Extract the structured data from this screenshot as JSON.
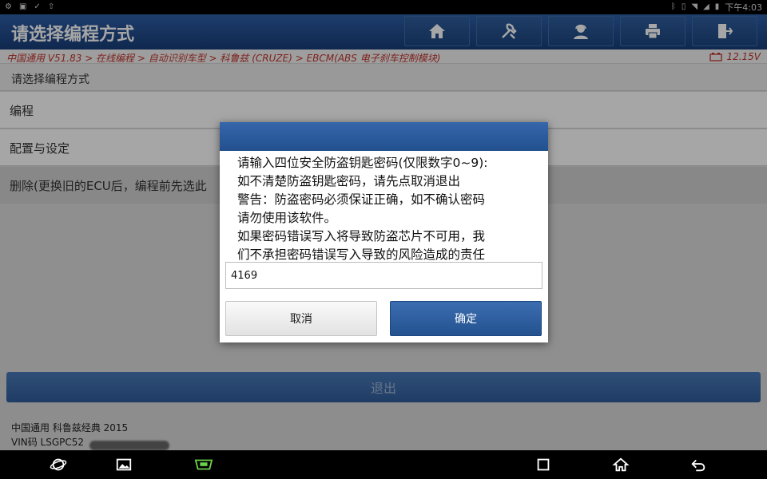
{
  "status_bar": {
    "left_icons": [
      "settings-icon",
      "image-icon",
      "check-icon",
      "upload-icon"
    ],
    "right_icons": [
      "bluetooth-icon",
      "vibrate-icon",
      "wifi-icon",
      "signal-icon",
      "battery-icon"
    ],
    "time": "下午4:03"
  },
  "header": {
    "title": "请选择编程方式",
    "buttons": [
      "home-icon",
      "diagnose-icon",
      "support-icon",
      "print-icon",
      "exit-icon"
    ]
  },
  "breadcrumb": {
    "text": "中国通用 V51.83 > 在线编程 > 自动识别车型 > 科鲁兹 (CRUZE) > EBCM(ABS 电子刹车控制模块)",
    "voltage": "12.15V"
  },
  "list": {
    "header": "请选择编程方式",
    "items": [
      "编程",
      "配置与设定",
      "删除(更换旧的ECU后，编程前先选此"
    ]
  },
  "footer": {
    "exit_label": "退出",
    "vehicle": "中国通用 科鲁兹经典 2015",
    "vin": "VIN码 LSGPC52"
  },
  "dialog": {
    "message_lines": [
      "请输入四位安全防盗钥匙密码(仅限数字0~9):",
      "如不清楚防盗钥匙密码，请先点取消退出",
      "警告：防盗密码必须保证正确，如不确认密码",
      "请勿使用该软件。",
      "如果密码错误写入将导致防盗芯片不可用，我",
      "们不承担密码错误写入导致的风险造成的责任"
    ],
    "pin_value": "4169",
    "cancel_label": "取消",
    "ok_label": "确定"
  },
  "nav_bar": [
    "browser-icon",
    "gallery-icon",
    "vci-icon",
    "recent-apps-icon",
    "home-icon",
    "back-icon"
  ],
  "colors": {
    "header_blue": "#1f4a8c",
    "accent_blue": "#2b5a9e",
    "breadcrumb_red": "#c0332c"
  }
}
